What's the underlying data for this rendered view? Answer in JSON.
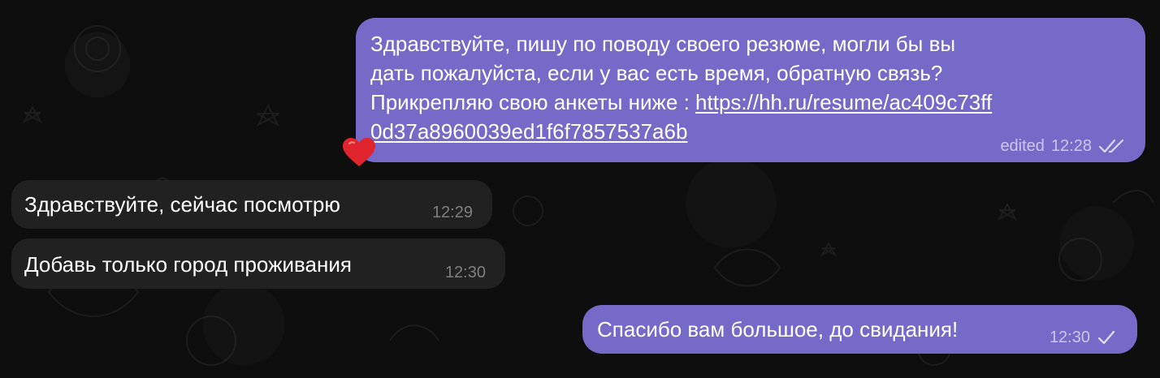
{
  "messages": [
    {
      "direction": "outgoing",
      "text_lines": [
        "Здравствуйте, пишу по поводу своего резюме, могли бы вы",
        "дать пожалуйста, если у вас есть время, обратную связь?",
        "Прикрепляю свою анкеты ниже : "
      ],
      "link_line_1": "https://hh.ru/resume/ac409c73ff",
      "link_line_2": "0d37a8960039ed1f6f7857537a6b",
      "edited_label": "edited",
      "time": "12:28",
      "status": "read",
      "status_icon": "double-check-icon",
      "reaction": "heart-icon",
      "reaction_color": "#e0262c"
    },
    {
      "direction": "incoming",
      "text": "Здравствуйте, сейчас посмотрю",
      "time": "12:29"
    },
    {
      "direction": "incoming",
      "text": "Добавь только город проживания",
      "time": "12:30"
    },
    {
      "direction": "outgoing",
      "text": "Спасибо вам большое, до свидания!",
      "time": "12:30",
      "status": "sent",
      "status_icon": "single-check-icon"
    }
  ],
  "colors": {
    "outgoing_bubble": "#766ac8",
    "incoming_bubble": "#212121",
    "background": "#0e0e0e"
  }
}
